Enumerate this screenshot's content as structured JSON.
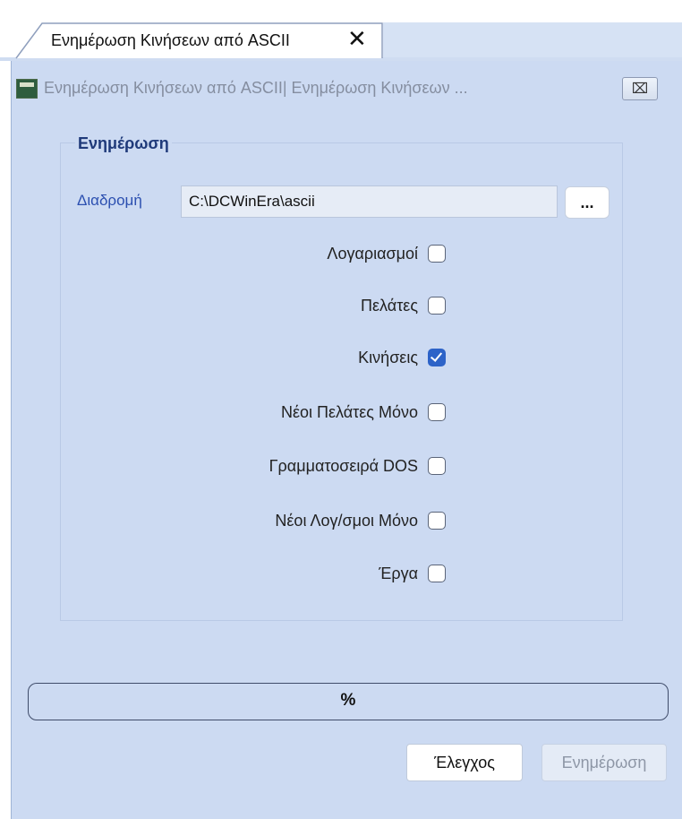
{
  "tab": {
    "label": "Ενημέρωση Κινήσεων από ASCII",
    "close": "✕"
  },
  "window": {
    "title": "Ενημέρωση Κινήσεων από ASCII| Ενημέρωση Κινήσεων ...",
    "close": "⌧"
  },
  "group": {
    "title": "Ενημέρωση",
    "path_label": "Διαδρομή",
    "path_value": "C:\\DCWinEra\\ascii",
    "browse_label": "...",
    "options": [
      {
        "label": "Λογαριασμοί",
        "checked": false
      },
      {
        "label": "Πελάτες",
        "checked": false
      },
      {
        "label": "Κινήσεις",
        "checked": true
      },
      {
        "label": "Νέοι Πελάτες Μόνο",
        "checked": false
      },
      {
        "label": "Γραμματοσειρά DOS",
        "checked": false
      },
      {
        "label": "Νέοι Λογ/σμοι Μόνο",
        "checked": false
      },
      {
        "label": "Έργα",
        "checked": false
      }
    ]
  },
  "progress": {
    "text": "%",
    "percent": 0
  },
  "buttons": {
    "check_label": "Έλεγχος",
    "update_label": "Ενημέρωση",
    "update_enabled": false
  },
  "colors": {
    "accent": "#2d63c8",
    "background": "#ccdaf2",
    "label_blue": "#2b4fb0"
  }
}
